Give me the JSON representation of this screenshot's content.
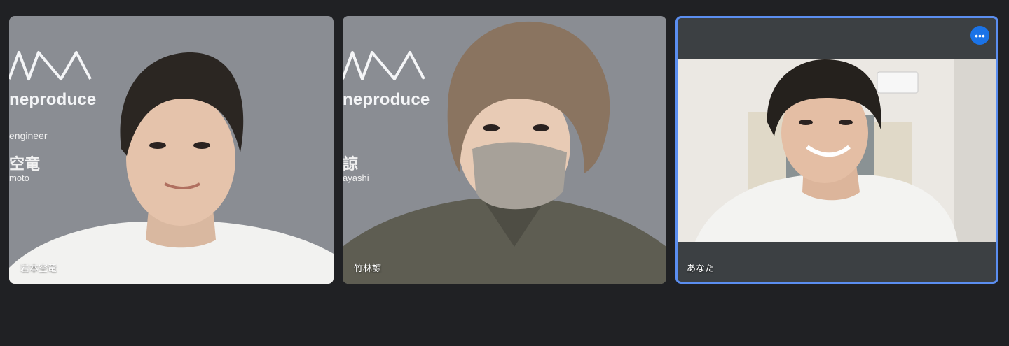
{
  "participants": [
    {
      "name": "岩本空竜",
      "background": {
        "brand": "neproduce",
        "role": "engineer",
        "name_jp": "空竜",
        "name_en": "moto"
      }
    },
    {
      "name": "竹林諒",
      "background": {
        "brand": "neproduce",
        "name_jp": "諒",
        "name_en": "ayashi"
      }
    },
    {
      "name": "あなた",
      "more_icon": "more-horizontal-icon",
      "more_glyph": "•••"
    }
  ],
  "colors": {
    "page_bg": "#202124",
    "tile_bg": "#8a8d93",
    "active_border": "#5b8ef0",
    "more_button": "#1a73e8"
  }
}
